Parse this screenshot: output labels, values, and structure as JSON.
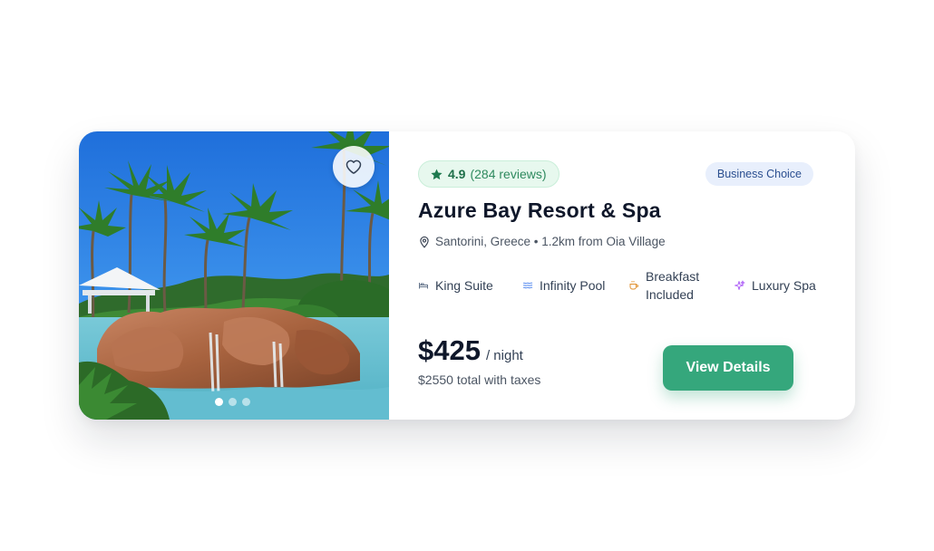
{
  "listing": {
    "image_alt": "Tropical resort pool with rock waterfall and palm trees",
    "carousel": {
      "slides": 3,
      "active": 1
    },
    "favorite": {
      "icon": "heart-icon",
      "saved": false
    },
    "rating": {
      "icon": "star-icon",
      "score": "4.9",
      "reviews": "(284 reviews)"
    },
    "badge": "Business Choice",
    "title": "Azure Bay Resort & Spa",
    "location": {
      "icon": "map-pin-icon",
      "text": "Santorini, Greece • 1.2km from Oia Village"
    },
    "amenities": [
      {
        "icon": "bed-icon",
        "label": "King Suite",
        "color": "#64748b"
      },
      {
        "icon": "waves-icon",
        "label": "Infinity Pool",
        "color": "#5b8def"
      },
      {
        "icon": "coffee-icon",
        "label": "Breakfast Included",
        "color": "#e0902f"
      },
      {
        "icon": "sparkle-icon",
        "label": "Luxury Spa",
        "color": "#a855f7"
      }
    ],
    "price": {
      "amount": "$425",
      "unit": "/ night",
      "total": "$2550 total with taxes"
    },
    "cta": "View Details"
  },
  "colors": {
    "accent": "#35a77c",
    "rating_bg": "#e7f8ee",
    "badge_bg": "#e8effc",
    "badge_text": "#2b4f8f",
    "title": "#0f172a"
  }
}
